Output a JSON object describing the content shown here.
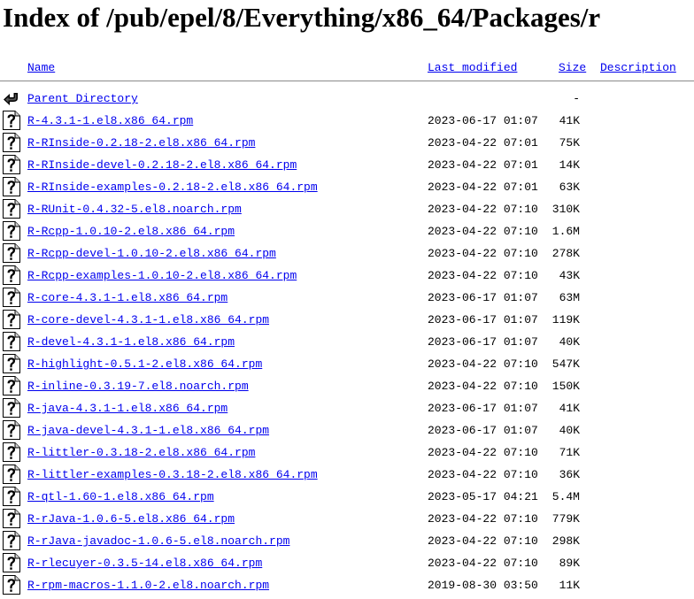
{
  "page": {
    "title": "Index of /pub/epel/8/Everything/x86_64/Packages/r"
  },
  "columns": {
    "name": "Name",
    "last_modified": "Last modified",
    "size": "Size",
    "description": "Description"
  },
  "parent": {
    "label": "Parent Directory",
    "size": "-",
    "icon": "back-arrow-icon"
  },
  "file_icon": "unknown-file-icon",
  "files": [
    {
      "name": "R-4.3.1-1.el8.x86_64.rpm",
      "modified": "2023-06-17 01:07",
      "size": "41K"
    },
    {
      "name": "R-RInside-0.2.18-2.el8.x86_64.rpm",
      "modified": "2023-04-22 07:01",
      "size": "75K"
    },
    {
      "name": "R-RInside-devel-0.2.18-2.el8.x86_64.rpm",
      "modified": "2023-04-22 07:01",
      "size": "14K"
    },
    {
      "name": "R-RInside-examples-0.2.18-2.el8.x86_64.rpm",
      "modified": "2023-04-22 07:01",
      "size": "63K"
    },
    {
      "name": "R-RUnit-0.4.32-5.el8.noarch.rpm",
      "modified": "2023-04-22 07:10",
      "size": "310K"
    },
    {
      "name": "R-Rcpp-1.0.10-2.el8.x86_64.rpm",
      "modified": "2023-04-22 07:10",
      "size": "1.6M"
    },
    {
      "name": "R-Rcpp-devel-1.0.10-2.el8.x86_64.rpm",
      "modified": "2023-04-22 07:10",
      "size": "278K"
    },
    {
      "name": "R-Rcpp-examples-1.0.10-2.el8.x86_64.rpm",
      "modified": "2023-04-22 07:10",
      "size": "43K"
    },
    {
      "name": "R-core-4.3.1-1.el8.x86_64.rpm",
      "modified": "2023-06-17 01:07",
      "size": "63M"
    },
    {
      "name": "R-core-devel-4.3.1-1.el8.x86_64.rpm",
      "modified": "2023-06-17 01:07",
      "size": "119K"
    },
    {
      "name": "R-devel-4.3.1-1.el8.x86_64.rpm",
      "modified": "2023-06-17 01:07",
      "size": "40K"
    },
    {
      "name": "R-highlight-0.5.1-2.el8.x86_64.rpm",
      "modified": "2023-04-22 07:10",
      "size": "547K"
    },
    {
      "name": "R-inline-0.3.19-7.el8.noarch.rpm",
      "modified": "2023-04-22 07:10",
      "size": "150K"
    },
    {
      "name": "R-java-4.3.1-1.el8.x86_64.rpm",
      "modified": "2023-06-17 01:07",
      "size": "41K"
    },
    {
      "name": "R-java-devel-4.3.1-1.el8.x86_64.rpm",
      "modified": "2023-06-17 01:07",
      "size": "40K"
    },
    {
      "name": "R-littler-0.3.18-2.el8.x86_64.rpm",
      "modified": "2023-04-22 07:10",
      "size": "71K"
    },
    {
      "name": "R-littler-examples-0.3.18-2.el8.x86_64.rpm",
      "modified": "2023-04-22 07:10",
      "size": "36K"
    },
    {
      "name": "R-qtl-1.60-1.el8.x86_64.rpm",
      "modified": "2023-05-17 04:21",
      "size": "5.4M"
    },
    {
      "name": "R-rJava-1.0.6-5.el8.x86_64.rpm",
      "modified": "2023-04-22 07:10",
      "size": "779K"
    },
    {
      "name": "R-rJava-javadoc-1.0.6-5.el8.noarch.rpm",
      "modified": "2023-04-22 07:10",
      "size": "298K"
    },
    {
      "name": "R-rlecuyer-0.3.5-14.el8.x86_64.rpm",
      "modified": "2023-04-22 07:10",
      "size": "89K"
    },
    {
      "name": "R-rpm-macros-1.1.0-2.el8.noarch.rpm",
      "modified": "2019-08-30 03:50",
      "size": "11K"
    }
  ]
}
